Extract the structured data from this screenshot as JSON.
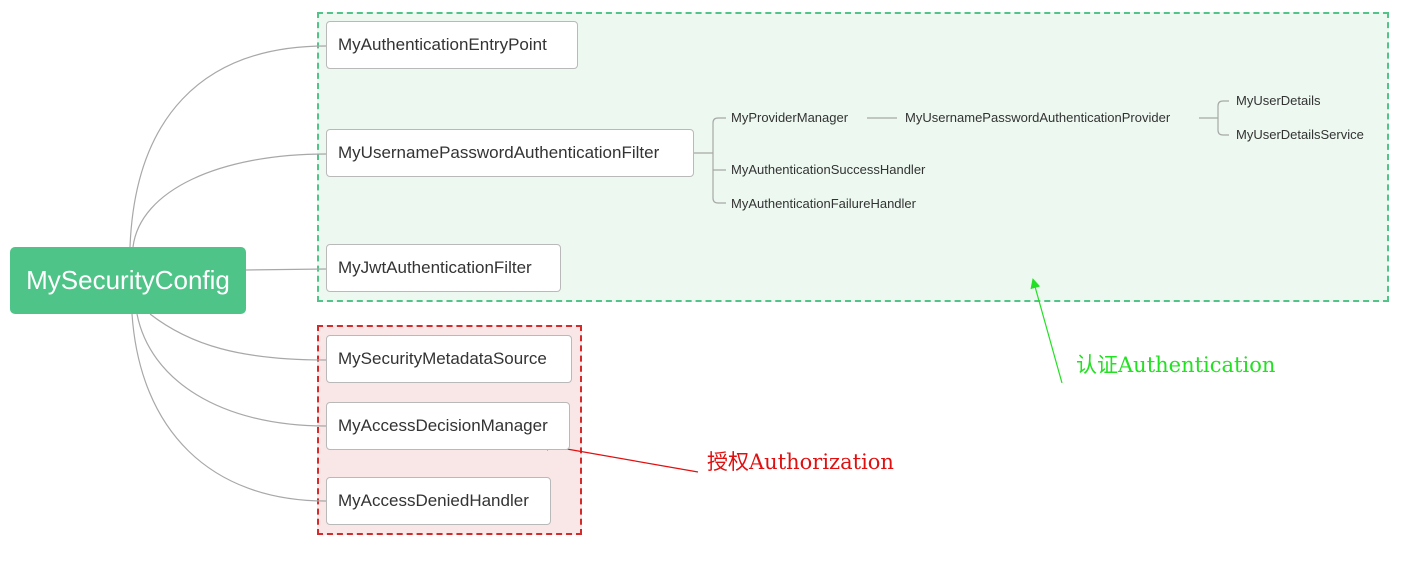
{
  "root": {
    "label": "MySecurityConfig"
  },
  "authentication_group": {
    "annotation": "认证Authentication",
    "nodes": {
      "entry_point": "MyAuthenticationEntryPoint",
      "username_password_filter": "MyUsernamePasswordAuthenticationFilter",
      "jwt_filter": "MyJwtAuthenticationFilter"
    },
    "filter_children": {
      "provider_manager": "MyProviderManager",
      "provider": "MyUsernamePasswordAuthenticationProvider",
      "user_details": "MyUserDetails",
      "user_details_service": "MyUserDetailsService",
      "success_handler": "MyAuthenticationSuccessHandler",
      "failure_handler": "MyAuthenticationFailureHandler"
    }
  },
  "authorization_group": {
    "annotation": "授权Authorization",
    "nodes": {
      "metadata_source": "MySecurityMetadataSource",
      "decision_manager": "MyAccessDecisionManager",
      "denied_handler": "MyAccessDeniedHandler"
    }
  },
  "colors": {
    "root_fill": "#4fc488",
    "auth_border": "#52c489",
    "auth_fill": "#ecf8f0",
    "authz_border": "#d42a2a",
    "authz_fill": "#f9e6e6",
    "auth_annotation": "#22e022",
    "authz_annotation": "#e01010",
    "connector": "#a8a8a8"
  }
}
